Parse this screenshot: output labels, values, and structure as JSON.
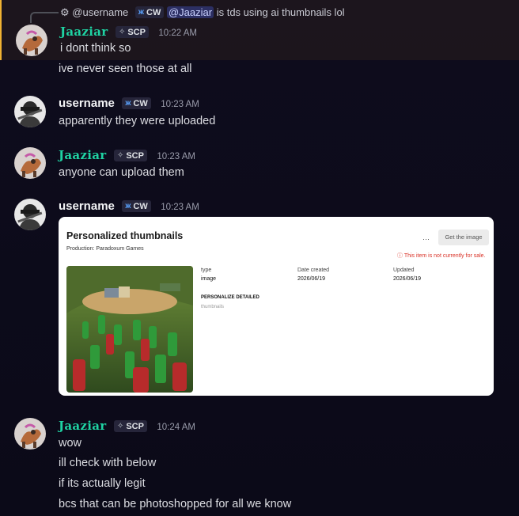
{
  "reply": {
    "username": "@username",
    "tag": "CW",
    "mention": "@Jaaziar",
    "text": "is tds using ai thumbnails lol"
  },
  "messages": [
    {
      "author": "Jaaziar",
      "tag": "SCP",
      "time": "10:22 AM",
      "lines": [
        "i dont think so",
        "ive never seen those at all"
      ]
    },
    {
      "author": "username",
      "tag": "CW",
      "time": "10:23 AM",
      "lines": [
        "apparently they were uploaded"
      ]
    },
    {
      "author": "Jaaziar",
      "tag": "SCP",
      "time": "10:23 AM",
      "lines": [
        "anyone can upload them"
      ]
    },
    {
      "author": "username",
      "tag": "CW",
      "time": "10:23 AM",
      "lines": []
    },
    {
      "author": "Jaaziar",
      "tag": "SCP",
      "time": "10:24 AM",
      "lines": [
        "wow",
        "ill check with below",
        "if its actually legit",
        "bcs that can be photoshopped for all we know"
      ]
    }
  ],
  "embed": {
    "title": "Personalized thumbnails",
    "production": "Production: Paradoxum Games",
    "menu": "···",
    "button": "Get the image",
    "warning": "ⓘ This item is not currently for sale.",
    "type_label": "type",
    "type_value": "image",
    "created_label": "Date created",
    "created_value": "2026/06/19",
    "updated_label": "Updated",
    "updated_value": "2026/06/19",
    "section": "PERSONALIZE DETAILED",
    "section_value": "thumbnails"
  },
  "colors": {
    "jaaziar": "#1fd3a3",
    "mention_bg": "#2c2f63",
    "highlight": "#f0b232",
    "background": "#0d0b1b"
  },
  "icons": {
    "cw": "butterfly-icon",
    "scp": "sparkle-icon"
  }
}
